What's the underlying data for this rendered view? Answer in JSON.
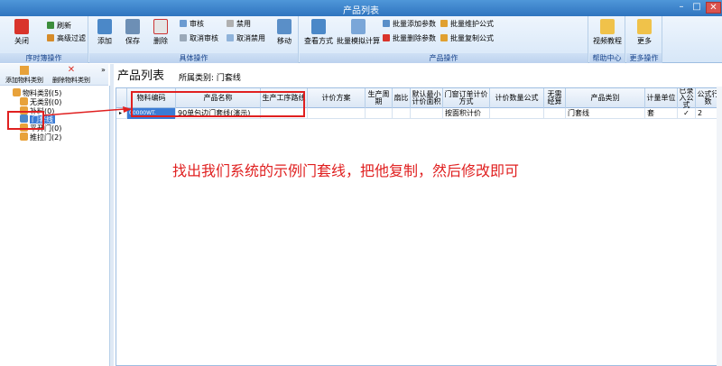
{
  "window": {
    "title": "产品列表",
    "min": "–",
    "max": "□",
    "close": "✕"
  },
  "ribbon": {
    "groups": {
      "g1": "序时簿操作",
      "g2": "具体操作",
      "g3": "产品操作",
      "g4": "帮助中心",
      "g5": "更多操作"
    },
    "buttons": {
      "close": "关闭",
      "refresh": "刷新",
      "advfilter": "高级过滤",
      "add": "添加",
      "save": "保存",
      "delete": "删除",
      "audit": "审核",
      "unaudit": "取消审核",
      "disable": "禁用",
      "undisable": "取消禁用",
      "move": "移动",
      "viewmethod": "查看方式",
      "batchcalc": "批量模拟计算",
      "batchaddparam": "批量添加参数",
      "batchdelparam": "批量删除参数",
      "batchmaintain": "批量维护公式",
      "batchcopy": "批量复制公式",
      "video": "视频教程",
      "more": "更多"
    }
  },
  "toolbar2": {
    "add_category": "添加物料类别",
    "del_category": "删除物料类别",
    "chevron": "»"
  },
  "page": {
    "title": "产品列表",
    "category_label": "所属类别: 门套线"
  },
  "tree": {
    "items": [
      "物料类别(5)",
      "无类别(0)",
      "补料(0)",
      "门套线",
      "平开门(0)",
      "推拉门(2)"
    ]
  },
  "grid": {
    "headers": [
      "物料编码",
      "产品名称",
      "生产工序路线",
      "计价方案",
      "生产周期",
      "扇比",
      "默认最小计价面积",
      "门窗订单计价方式",
      "计价数量公式",
      "无需经算",
      "产品类别",
      "计量单位",
      "已录入公式",
      "公式行数"
    ],
    "row": {
      "code": "00000WT.",
      "name": "90单包边门套线(演示)",
      "route": "",
      "pricing": "",
      "cycle": "",
      "ratio": "",
      "minarea": "",
      "method": "按面积计价",
      "qtyformula": "",
      "noneed": "",
      "category": "门套线",
      "unit": "套",
      "entered": "✓",
      "lines": "2"
    }
  },
  "annotation": "找出我们系统的示例门套线，把他复制，然后修改即可",
  "colors": {
    "accent": "#2f74bf",
    "annotation": "#e02020"
  }
}
